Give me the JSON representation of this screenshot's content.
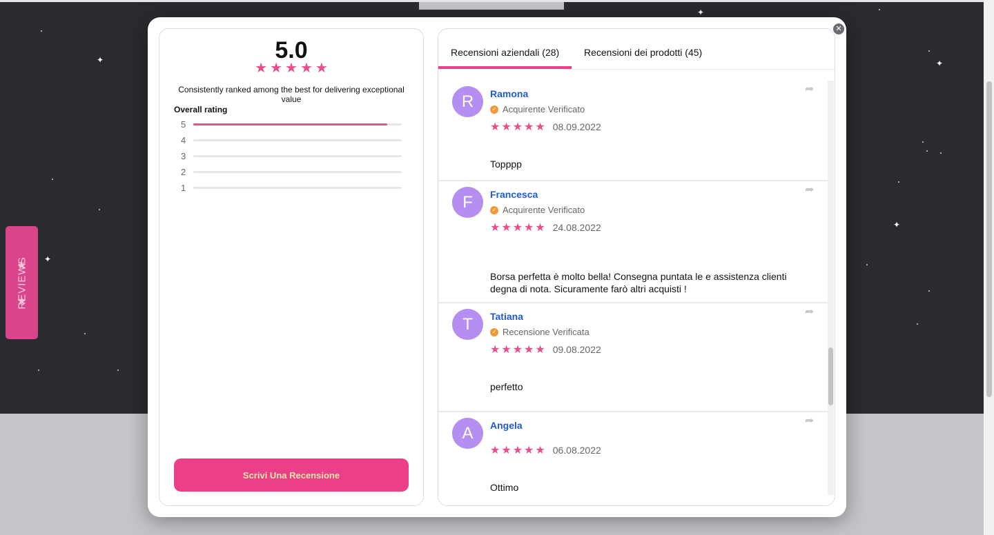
{
  "overlay": {
    "reviews_tab_label": "REVIEWS",
    "star_icon": "★",
    "close_icon": "✕"
  },
  "summary": {
    "average": "5.0",
    "average_stars": 5,
    "tagline": "Consistently ranked among the best for delivering exceptional value",
    "overall_label": "Overall rating",
    "distribution": [
      {
        "label": "5",
        "fraction": 0.93
      },
      {
        "label": "4",
        "fraction": 0
      },
      {
        "label": "3",
        "fraction": 0
      },
      {
        "label": "2",
        "fraction": 0
      },
      {
        "label": "1",
        "fraction": 0
      }
    ],
    "write_button": "Scrivi Una Recensione"
  },
  "tabs": {
    "company": "Recensioni aziendali (28)",
    "products": "Recensioni dei prodotti (45)"
  },
  "reviews": [
    {
      "initial": "R",
      "name": "Ramona",
      "verified": "Acquirente Verificato",
      "rating": 5,
      "date": "08.09.2022",
      "text": "Topppp"
    },
    {
      "initial": "F",
      "name": "Francesca",
      "verified": "Acquirente Verificato",
      "rating": 5,
      "date": "24.08.2022",
      "text": "Borsa perfetta è molto bella! Consegna puntata le e assistenza clienti degna di nota. Sicuramente farò altri acquisti !"
    },
    {
      "initial": "T",
      "name": "Tatiana",
      "verified": "Recensione Verificata",
      "rating": 5,
      "date": "09.08.2022",
      "text": "perfetto"
    },
    {
      "initial": "A",
      "name": "Angela",
      "verified": "",
      "rating": 5,
      "date": "06.08.2022",
      "text": "Ottimo"
    }
  ],
  "colors": {
    "accent": "#ec3f89",
    "avatar": "#b48ef0",
    "name_link": "#1e5ad2",
    "verified_badge": "#ef9b3a"
  }
}
